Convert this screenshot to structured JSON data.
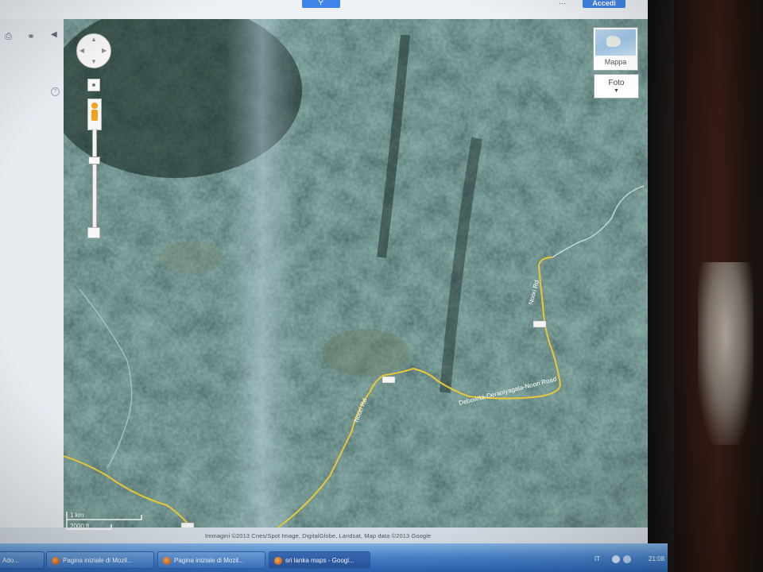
{
  "header": {
    "search_icon": "search-icon",
    "apps_icon": "apps-grid-icon",
    "signin_label": "Accedi"
  },
  "left_panel": {
    "print_icon": "print-icon",
    "link_icon": "link-icon",
    "collapse_icon": "collapse-icon"
  },
  "map": {
    "type_switcher": {
      "map_label": "Mappa",
      "satellite_label": "Foto"
    },
    "roads": [
      {
        "label": "Noori Rd",
        "color": "#e7c83a"
      },
      {
        "label": "Noori Rd",
        "color": "#e7c83a"
      },
      {
        "label": "Debowita-Deraniyagala-Noori Road",
        "color": "#e7c83a"
      }
    ],
    "scale": {
      "metric": "1 km",
      "imperial": "2000 ft"
    },
    "attribution": "Immagini ©2013 Cnes/Spot Image, DigitalGlobe, Landsat, Map data ©2013 Google"
  },
  "taskbar": {
    "tasks": [
      {
        "label": "Ado...",
        "active": false
      },
      {
        "label": "Pagina iniziale di Mozil...",
        "active": false
      },
      {
        "label": "Pagina iniziale di Mozil...",
        "active": false
      },
      {
        "label": "sri lanka maps - Googl...",
        "active": true
      }
    ],
    "language": "IT",
    "clock": "21:08"
  },
  "colors": {
    "accent": "#3f84e6",
    "road": "#e7c83a",
    "taskbar": "#4d88d0"
  }
}
